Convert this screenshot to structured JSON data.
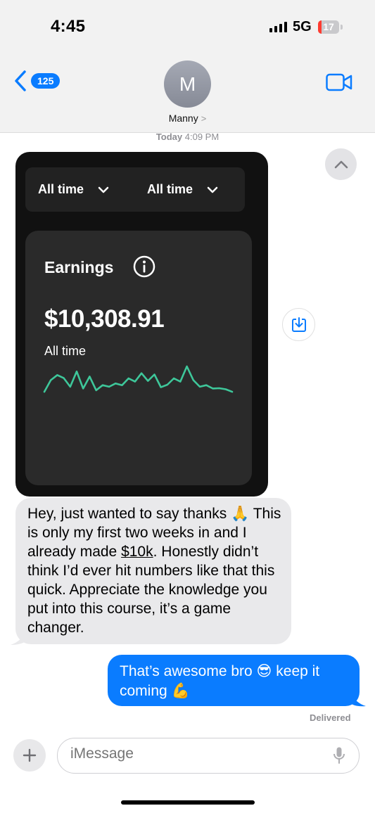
{
  "status_bar": {
    "time": "4:45",
    "network": "5G",
    "battery": "17",
    "battery_level": 0.17
  },
  "header": {
    "back_count": "125",
    "avatar_initial": "M",
    "contact_name": "Manny",
    "contact_chevron": ">"
  },
  "thread": {
    "timestamp_day": "Today",
    "timestamp_time": "4:09 PM"
  },
  "attachment": {
    "filter_1": "All time",
    "filter_2": "All time",
    "earnings_label": "Earnings",
    "earnings_value": "$10,308.91",
    "range_label": "All time",
    "sparkline": [
      0.0,
      0.46,
      0.66,
      0.54,
      0.2,
      0.8,
      0.13,
      0.6,
      0.06,
      0.26,
      0.2,
      0.33,
      0.26,
      0.53,
      0.4,
      0.73,
      0.43,
      0.68,
      0.18,
      0.28,
      0.53,
      0.4,
      1.0,
      0.46,
      0.2,
      0.26,
      0.13,
      0.14,
      0.1,
      0.0
    ]
  },
  "messages": {
    "incoming_pre": "Hey, just wanted to say thanks 🙏 This is only my first two weeks in and I already made ",
    "incoming_link": "$10k",
    "incoming_post": ". Honestly didn’t think I’d ever hit numbers like that this quick. Appreciate the knowledge you put into this course, it’s a game changer.",
    "outgoing": "That’s awesome bro 😎 keep it coming 💪",
    "status": "Delivered"
  },
  "composer": {
    "placeholder": "iMessage"
  },
  "colors": {
    "imessage_blue": "#0a7cff",
    "incoming_gray": "#e9e9eb",
    "sparkline_green": "#3ec79a",
    "battery_red": "#ff3b30"
  }
}
